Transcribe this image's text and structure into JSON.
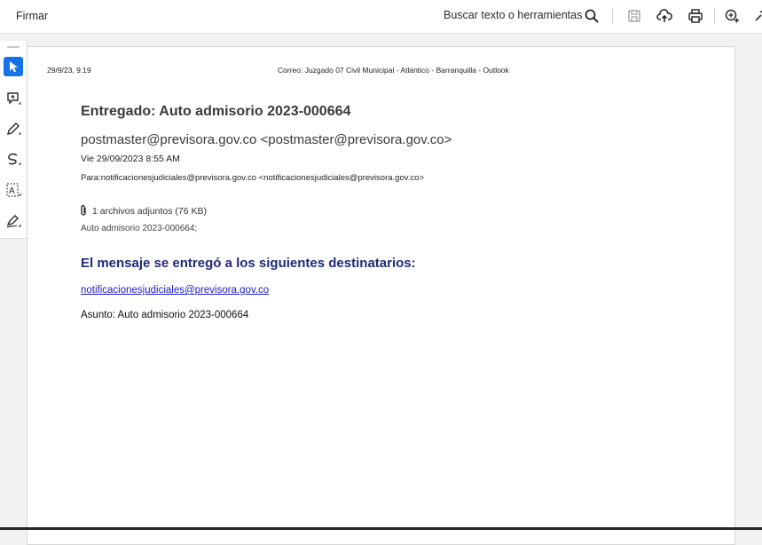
{
  "toolbar": {
    "sign_label": "Firmar",
    "search_label": "Buscar texto o herramientas",
    "icons": [
      "search-icon",
      "save-icon",
      "upload-cloud-icon",
      "print-icon",
      "zoom-add-icon",
      "link-icon"
    ]
  },
  "left_tools": [
    "select-icon",
    "add-comment-icon",
    "draw-pen-icon",
    "freehand-curve-icon",
    "text-recognition-icon",
    "sign-pen-icon"
  ],
  "document": {
    "header_date": "29/9/23, 9:19",
    "header_title": "Correo: Juzgado 07 Civil Municipal - Atlántico - Barranquilla - Outlook",
    "subject": "Entregado: Auto admisorio 2023-000664",
    "from": "postmaster@previsora.gov.co <postmaster@previsora.gov.co>",
    "date": "Vie 29/09/2023 8:55 AM",
    "to": "Para:notificacionesjudiciales@previsora.gov.co <notificacionesjudiciales@previsora.gov.co>",
    "attachments": "1 archivos adjuntos (76 KB)",
    "attachment_name": "Auto admisorio 2023-000664;",
    "delivered_heading": "El mensaje se entregó a los siguientes destinatarios:",
    "recipient_link": "notificacionesjudiciales@previsora.gov.co",
    "asunto": "Asunto: Auto admisorio 2023-000664"
  },
  "colors": {
    "accent": "#1473e6",
    "heading_blue": "#1f2a78",
    "link": "#1a1ad6"
  }
}
